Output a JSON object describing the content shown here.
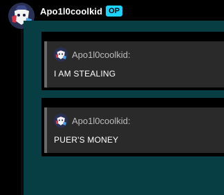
{
  "post": {
    "username": "Apo1l0coolkid",
    "badge": "OP"
  },
  "quotes": [
    {
      "author": "Apo1l0coolkid:",
      "text": "I AM STEALING"
    },
    {
      "author": "Apo1l0coolkid:",
      "text": "PUER'S MONEY"
    }
  ]
}
